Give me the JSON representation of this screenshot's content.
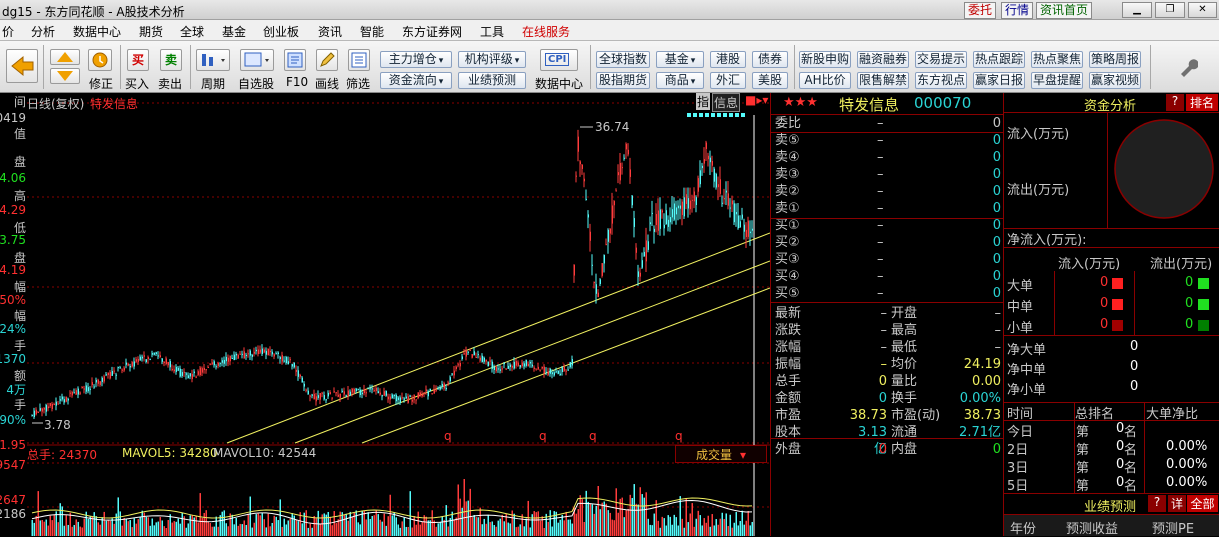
{
  "window": {
    "title": "dg15 - 东方同花顺 - A股技术分析",
    "btn_order": "委托",
    "btn_market": "行情",
    "btn_home": "资讯首页"
  },
  "menu": [
    "价",
    "分析",
    "数据中心",
    "期货",
    "全球",
    "基金",
    "创业板",
    "资讯",
    "智能",
    "东方证券网",
    "工具",
    "在线服务"
  ],
  "toolbar": {
    "big_labels": [
      "修正",
      "买入",
      "卖出",
      "周期",
      "自选股",
      "F10",
      "画线",
      "筛选",
      "数据中心"
    ],
    "buy_glyph": "买",
    "sell_glyph": "卖",
    "cpi_label": "CPI",
    "group1": [
      "主力增仓",
      "机构评级",
      "资金流向",
      "业绩预测"
    ],
    "group2": [
      "全球指数",
      "基金",
      "港股",
      "债券",
      "股指期货",
      "商品",
      "外汇",
      "美股"
    ],
    "group3": [
      "新股申购",
      "融资融券",
      "交易提示",
      "热点跟踪",
      "热点聚焦",
      "策略周报",
      "AH比价",
      "限售解禁",
      "东方视点",
      "赢家日报",
      "早盘提醒",
      "赢家视频"
    ]
  },
  "left_axis": [
    {
      "t": "间",
      "c": "#c8c8c8"
    },
    {
      "t": "0419",
      "c": "#c8c8c8"
    },
    {
      "t": "值",
      "c": "#c8c8c8"
    },
    {
      "t": "盘",
      "c": "#c8c8c8"
    },
    {
      "t": "4.06",
      "c": "#20e020"
    },
    {
      "t": "高",
      "c": "#c8c8c8"
    },
    {
      "t": "4.29",
      "c": "#ff3030"
    },
    {
      "t": "低",
      "c": "#c8c8c8"
    },
    {
      "t": "3.75",
      "c": "#20e020"
    },
    {
      "t": "盘",
      "c": "#c8c8c8"
    },
    {
      "t": "4.19",
      "c": "#ff3030"
    },
    {
      "t": "幅",
      "c": "#c8c8c8"
    },
    {
      "t": "50%",
      "c": "#ff3030"
    },
    {
      "t": "幅",
      "c": "#c8c8c8"
    },
    {
      "t": "24%",
      "c": "#2ad4d4"
    },
    {
      "t": "手",
      "c": "#c8c8c8"
    },
    {
      "t": "1370",
      "c": "#2ad4d4"
    },
    {
      "t": "额",
      "c": "#c8c8c8"
    },
    {
      "t": "4万",
      "c": "#2ad4d4"
    },
    {
      "t": "手",
      "c": "#c8c8c8"
    },
    {
      "t": "90%",
      "c": "#2ad4d4"
    },
    {
      "t": "1.95",
      "c": "#ff3030"
    },
    {
      "t": "9547",
      "c": "#ff3030"
    },
    {
      "t": "2647",
      "c": "#ff3030"
    },
    {
      "t": "2186",
      "c": "#c8c8c8"
    }
  ],
  "chart": {
    "period_label": "日线(复权)",
    "stock_label": "特发信息",
    "btn_zhi": "指",
    "btn_info": "信息",
    "high_label": "36.74",
    "low_label": "3.78",
    "q_marks": [
      "q",
      "q",
      "q",
      "q"
    ],
    "vol_title": "总手: 24370",
    "mavol5": "MAVOL5: 34280",
    "mavol10": "MAVOL10: 42544",
    "vol_dropdown": "成交量",
    "colors": {
      "up": "#ff3c3c",
      "down": "#54fcfc",
      "line": "#f0f060",
      "grid": "#8a0000"
    },
    "chart_data": {
      "type": "candlestick",
      "high": 36.74,
      "low": 3.78,
      "volume_total": 24370,
      "mavol5": 34280,
      "mavol10": 42544
    }
  },
  "quote": {
    "stars": "★★★",
    "name": "特发信息",
    "code": "000070",
    "rows": [
      {
        "l": "委比",
        "m": "–",
        "r": "0",
        "rc": "#c8c8c8"
      },
      {
        "l": "卖⑤",
        "m": "–",
        "r": "0"
      },
      {
        "l": "卖④",
        "m": "–",
        "r": "0"
      },
      {
        "l": "卖③",
        "m": "–",
        "r": "0"
      },
      {
        "l": "卖②",
        "m": "–",
        "r": "0"
      },
      {
        "l": "卖①",
        "m": "–",
        "r": "0"
      },
      {
        "l": "买①",
        "m": "–",
        "r": "0"
      },
      {
        "l": "买②",
        "m": "–",
        "r": "0"
      },
      {
        "l": "买③",
        "m": "–",
        "r": "0"
      },
      {
        "l": "买④",
        "m": "–",
        "r": "0"
      },
      {
        "l": "买⑤",
        "m": "–",
        "r": "0"
      }
    ],
    "stats": [
      {
        "l": "最新",
        "m": "–",
        "l2": "开盘",
        "r": "–"
      },
      {
        "l": "涨跌",
        "m": "–",
        "l2": "最高",
        "r": "–"
      },
      {
        "l": "涨幅",
        "m": "–",
        "l2": "最低",
        "r": "–"
      },
      {
        "l": "振幅",
        "m": "–",
        "l2": "均价",
        "r": "24.19"
      },
      {
        "l": "总手",
        "m": "0",
        "l2": "量比",
        "r": "0.00"
      },
      {
        "l": "金额",
        "m": "0",
        "l2": "换手",
        "r": "0.00%"
      },
      {
        "l": "市盈",
        "m": "38.73",
        "l2": "市盈(动)",
        "r": "38.73"
      },
      {
        "l": "股本",
        "m": "3.13亿",
        "l2": "流通",
        "r": "2.71亿"
      },
      {
        "l": "外盘",
        "m": "0",
        "l2": "内盘",
        "r": "0"
      }
    ]
  },
  "flow": {
    "title": "资金分析",
    "btn_q": "?",
    "btn_rank": "排名",
    "inflow": "流入(万元)",
    "outflow": "流出(万元)",
    "net": "净流入(万元):",
    "col_in": "流入(万元)",
    "col_out": "流出(万元)",
    "orders": [
      {
        "l": "大单",
        "a": "0",
        "b": "0"
      },
      {
        "l": "中单",
        "a": "0",
        "b": "0"
      },
      {
        "l": "小单",
        "a": "0",
        "b": "0"
      }
    ],
    "net_rows": [
      {
        "l": "净大单",
        "v": "0"
      },
      {
        "l": "净中单",
        "v": "0"
      },
      {
        "l": "净小单",
        "v": "0"
      }
    ],
    "rank_head": [
      "时间",
      "总排名",
      "大单净比"
    ],
    "rank_rows": [
      {
        "t": "今日",
        "n": "0",
        "p": ""
      },
      {
        "t": "2日",
        "n": "0",
        "p": "0.00%"
      },
      {
        "t": "3日",
        "n": "0",
        "p": "0.00%"
      },
      {
        "t": "5日",
        "n": "0",
        "p": "0.00%"
      }
    ],
    "rank_di": "第",
    "rank_ming": "名",
    "forecast_title": "业绩预测",
    "btn_detail": "详",
    "btn_all": "全部",
    "forecast_head": [
      "年份",
      "预测收益",
      "预测PE"
    ]
  }
}
